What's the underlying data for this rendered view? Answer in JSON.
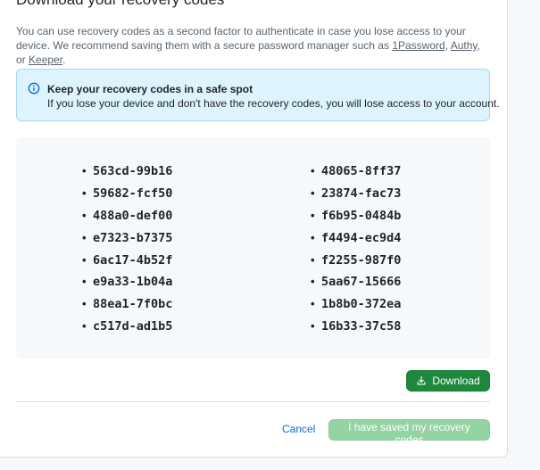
{
  "dialog": {
    "title": "Download your recovery codes",
    "description_before": "You can use recovery codes as a second factor to authenticate in case you lose access to your device. We recommend saving them with a secure password manager such as ",
    "links": [
      "1Password",
      "Authy",
      "Keeper"
    ],
    "sep_1": ", ",
    "sep_2": ", or ",
    "description_end": "."
  },
  "flash": {
    "icon": "info-icon",
    "title": "Keep your recovery codes in a safe spot",
    "text": "If you lose your device and don't have the recovery codes, you will lose access to your account."
  },
  "codes": {
    "left": [
      "563cd-99b16",
      "59682-fcf50",
      "488a0-def00",
      "e7323-b7375",
      "6ac17-4b52f",
      "e9a33-1b04a",
      "88ea1-7f0bc",
      "c517d-ad1b5"
    ],
    "right": [
      "48065-8ff37",
      "23874-fac73",
      "f6b95-0484b",
      "f4494-ec9d4",
      "f2255-987f0",
      "5aa67-15666",
      "1b8b0-372ea",
      "16b33-37c58"
    ]
  },
  "actions": {
    "download_label": "Download",
    "download_icon": "download-icon",
    "cancel_label": "Cancel",
    "saved_label": "I have saved my recovery codes"
  },
  "colors": {
    "primary_green": "#1f883d",
    "disabled_green": "#94d3a2",
    "link_blue": "#0969da",
    "info_bg": "#ddf4ff"
  }
}
